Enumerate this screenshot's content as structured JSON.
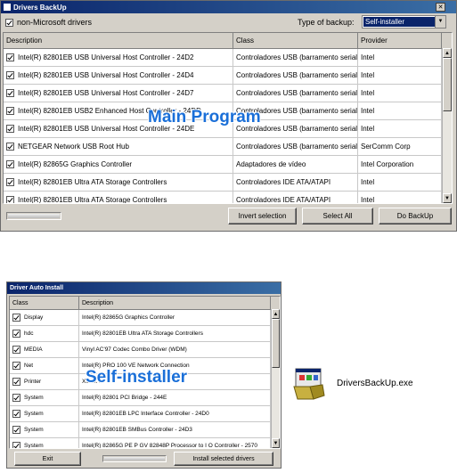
{
  "main": {
    "title": "Drivers BackUp",
    "checkbox_label": "non-Microsoft drivers",
    "backup_type_label": "Type of backup:",
    "backup_type_value": "Self-installer",
    "columns": [
      "Description",
      "Class",
      "Provider"
    ],
    "rows": [
      {
        "description": "Intel(R) 82801EB USB Universal Host Controller - 24D2",
        "class": "Controladores USB (barramento serial...",
        "provider": "Intel"
      },
      {
        "description": "Intel(R) 82801EB USB Universal Host Controller - 24D4",
        "class": "Controladores USB (barramento serial...",
        "provider": "Intel"
      },
      {
        "description": "Intel(R) 82801EB USB Universal Host Controller - 24D7",
        "class": "Controladores USB (barramento serial...",
        "provider": "Intel"
      },
      {
        "description": "Intel(R) 82801EB USB2 Enhanced Host Controller - 24DD",
        "class": "Controladores USB (barramento serial...",
        "provider": "Intel"
      },
      {
        "description": "Intel(R) 82801EB USB Universal Host Controller - 24DE",
        "class": "Controladores USB (barramento serial...",
        "provider": "Intel"
      },
      {
        "description": "NETGEAR Network USB Root Hub",
        "class": "Controladores USB (barramento serial...",
        "provider": "SerComm Corp"
      },
      {
        "description": "Intel(R) 82865G Graphics Controller",
        "class": "Adaptadores de vídeo",
        "provider": "Intel Corporation"
      },
      {
        "description": "Intel(R) 82801EB Ultra ATA Storage Controllers",
        "class": "Controladores IDE ATA/ATAPI",
        "provider": "Intel"
      },
      {
        "description": "Intel(R) 82801EB Ultra ATA Storage Controllers",
        "class": "Controladores IDE ATA/ATAPI",
        "provider": "Intel"
      }
    ],
    "buttons": {
      "invert": "Invert selection",
      "select_all": "Select All",
      "backup": "Do BackUp"
    },
    "overlay": "Main Program"
  },
  "installer": {
    "title": "Driver Auto Install",
    "columns": [
      "Class",
      "Description"
    ],
    "rows": [
      {
        "class": "Display",
        "description": "Intel(R) 82865G Graphics Controller"
      },
      {
        "class": "hdc",
        "description": "Intel(R) 82801EB Ultra ATA Storage Controllers"
      },
      {
        "class": "MEDIA",
        "description": "Vinyl AC'97 Codec Combo Driver (WDM)"
      },
      {
        "class": "Net",
        "description": "Intel(R) PRO 100 VE Network Connection"
      },
      {
        "class": "Printer",
        "description": "Xerox ..."
      },
      {
        "class": "System",
        "description": "Intel(R) 82801 PCI Bridge - 244E"
      },
      {
        "class": "System",
        "description": "Intel(R) 82801EB LPC Interface Controller - 24D0"
      },
      {
        "class": "System",
        "description": "Intel(R) 82801EB SMBus Controller - 24D3"
      },
      {
        "class": "System",
        "description": "Intel(R) 82865G PE P GV 82848P Processor to I O Controller - 2570"
      }
    ],
    "buttons": {
      "exit": "Exit",
      "install": "Install selected drivers"
    },
    "overlay": "Self-installer"
  },
  "exe": {
    "filename": "DriversBackUp.exe",
    "icon": "installer-icon"
  },
  "colors": {
    "overlay": "#1a6fd8",
    "titlebar": "#0a246a",
    "window": "#d4d0c8"
  }
}
